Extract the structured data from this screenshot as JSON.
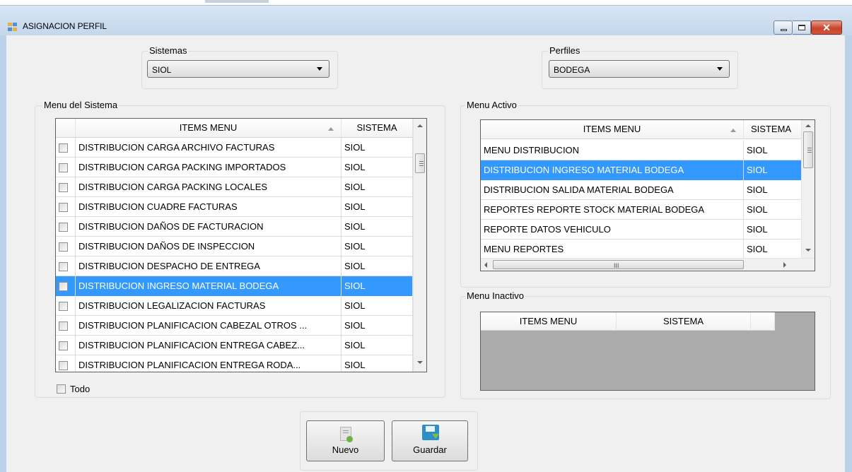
{
  "window": {
    "title": "ASIGNACION PERFIL"
  },
  "sistemas": {
    "label": "Sistemas",
    "selected": "SIOL"
  },
  "perfiles": {
    "label": "Perfiles",
    "selected": "BODEGA"
  },
  "menu_sistema": {
    "label": "Menu del Sistema",
    "columns": [
      "ITEMS MENU",
      "SISTEMA"
    ],
    "rows": [
      {
        "item": "DISTRIBUCION CARGA ARCHIVO FACTURAS",
        "sistema": "SIOL"
      },
      {
        "item": "DISTRIBUCION CARGA PACKING IMPORTADOS",
        "sistema": "SIOL"
      },
      {
        "item": "DISTRIBUCION CARGA PACKING LOCALES",
        "sistema": "SIOL"
      },
      {
        "item": "DISTRIBUCION CUADRE FACTURAS",
        "sistema": "SIOL"
      },
      {
        "item": "DISTRIBUCION DAÑOS DE FACTURACION",
        "sistema": "SIOL"
      },
      {
        "item": "DISTRIBUCION DAÑOS DE INSPECCION",
        "sistema": "SIOL"
      },
      {
        "item": "DISTRIBUCION DESPACHO DE ENTREGA",
        "sistema": "SIOL"
      },
      {
        "item": "DISTRIBUCION INGRESO MATERIAL BODEGA",
        "sistema": "SIOL"
      },
      {
        "item": "DISTRIBUCION LEGALIZACION FACTURAS",
        "sistema": "SIOL"
      },
      {
        "item": "DISTRIBUCION PLANIFICACION CABEZAL OTROS ...",
        "sistema": "SIOL"
      },
      {
        "item": "DISTRIBUCION PLANIFICACION ENTREGA CABEZ...",
        "sistema": "SIOL"
      },
      {
        "item": "DISTRIBUCION PLANIFICACION ENTREGA RODA...",
        "sistema": "SIOL"
      }
    ],
    "selected_index": 7,
    "todo_label": "Todo"
  },
  "menu_activo": {
    "label": "Menu Activo",
    "columns": [
      "ITEMS MENU",
      "SISTEMA"
    ],
    "rows": [
      {
        "item": "MENU DISTRIBUCION",
        "sistema": "SIOL"
      },
      {
        "item": "DISTRIBUCION INGRESO MATERIAL BODEGA",
        "sistema": "SIOL"
      },
      {
        "item": "DISTRIBUCION SALIDA MATERIAL BODEGA",
        "sistema": "SIOL"
      },
      {
        "item": "REPORTES REPORTE STOCK MATERIAL BODEGA",
        "sistema": "SIOL"
      },
      {
        "item": "REPORTE DATOS VEHICULO",
        "sistema": "SIOL"
      },
      {
        "item": "MENU REPORTES",
        "sistema": "SIOL"
      }
    ],
    "selected_index": 1
  },
  "menu_inactivo": {
    "label": "Menu Inactivo",
    "columns": [
      "ITEMS MENU",
      "SISTEMA"
    ]
  },
  "buttons": {
    "nuevo": "Nuevo",
    "guardar": "Guardar"
  },
  "colors": {
    "selection": "#3399ff",
    "empty_grid": "#ababab",
    "form_bg": "#f0f0f0",
    "frame": "#bcd2ea"
  },
  "icons": {
    "app": "form-icon",
    "nuevo": "new-document-icon",
    "guardar": "save-floppy-icon"
  }
}
